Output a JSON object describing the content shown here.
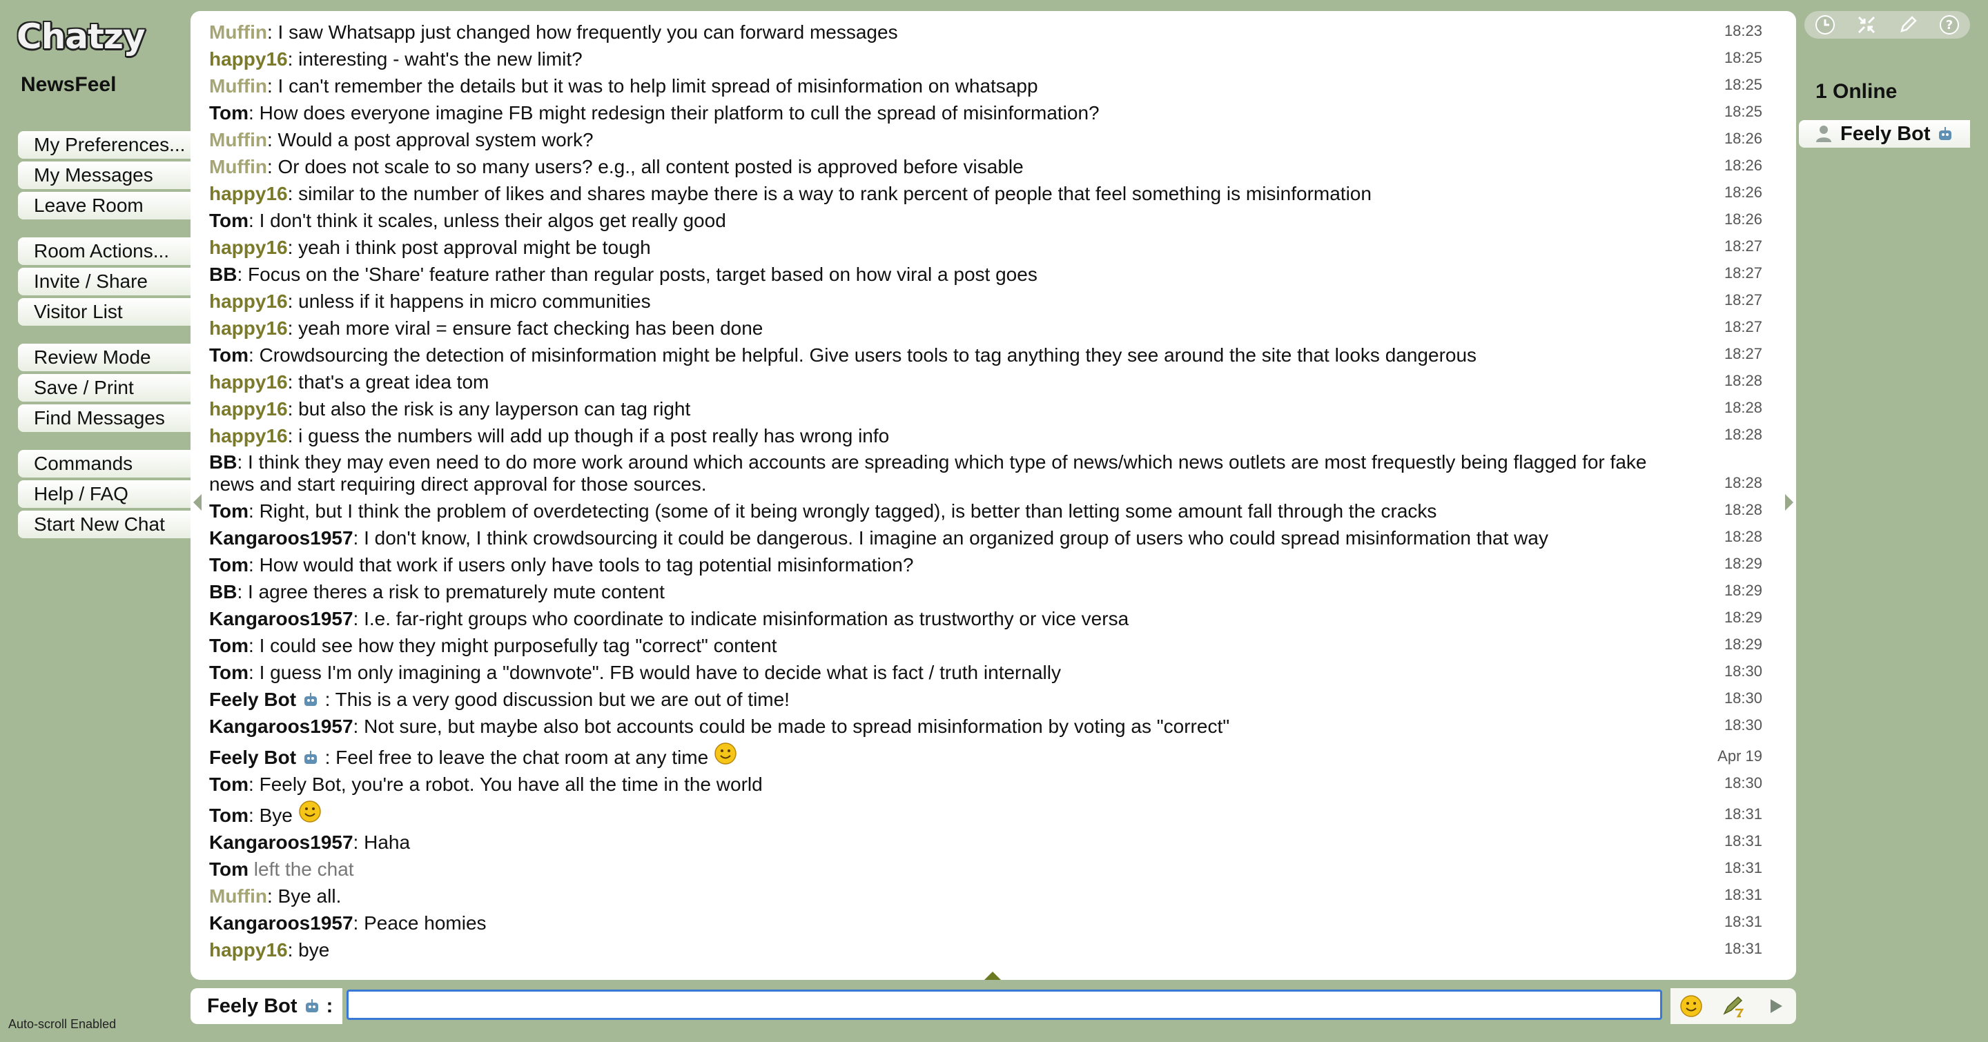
{
  "app": {
    "logo": "Chatzy",
    "room_name": "NewsFeel",
    "status": "Auto-scroll Enabled"
  },
  "menu": {
    "group1": [
      "My Preferences...",
      "My Messages",
      "Leave Room"
    ],
    "group2": [
      "Room Actions...",
      "Invite / Share",
      "Visitor List"
    ],
    "group3": [
      "Review Mode",
      "Save / Print",
      "Find Messages"
    ],
    "group4": [
      "Commands",
      "Help / FAQ",
      "Start New Chat"
    ]
  },
  "messages": [
    {
      "user": "Muffin",
      "color": "muffin",
      "text": ": I saw Whatsapp just changed how frequently you can forward messages",
      "time": "18:23"
    },
    {
      "user": "happy16",
      "color": "happy",
      "text": ": interesting - waht's the new limit?",
      "time": "18:25"
    },
    {
      "user": "Muffin",
      "color": "muffin",
      "text": ": I can't remember the details but it was to help limit spread of misinformation on whatsapp",
      "time": "18:25"
    },
    {
      "user": "Tom",
      "color": "dark",
      "text": ": How does everyone imagine FB might redesign their platform to cull the spread of misinformation?",
      "time": "18:25"
    },
    {
      "user": "Muffin",
      "color": "muffin",
      "text": ": Would a post approval system work?",
      "time": "18:26"
    },
    {
      "user": "Muffin",
      "color": "muffin",
      "text": ": Or does not scale to so many users? e.g., all content posted is approved before visable",
      "time": "18:26"
    },
    {
      "user": "happy16",
      "color": "happy",
      "text": ": similar to the number of likes and shares maybe there is a way to rank percent of people that feel something is misinformation",
      "time": "18:26"
    },
    {
      "user": "Tom",
      "color": "dark",
      "text": ": I don't think it scales, unless their algos get really good",
      "time": "18:26"
    },
    {
      "user": "happy16",
      "color": "happy",
      "text": ": yeah i think post approval might be tough",
      "time": "18:27"
    },
    {
      "user": "BB",
      "color": "dark",
      "text": ": Focus on the 'Share' feature rather than regular posts, target based on how viral a post goes",
      "time": "18:27"
    },
    {
      "user": "happy16",
      "color": "happy",
      "text": ": unless if it happens in micro communities",
      "time": "18:27"
    },
    {
      "user": "happy16",
      "color": "happy",
      "text": ": yeah more viral = ensure fact checking has been done",
      "time": "18:27"
    },
    {
      "user": "Tom",
      "color": "dark",
      "text": ": Crowdsourcing the detection of misinformation might be helpful. Give users tools to tag anything they see around the site that looks dangerous",
      "time": "18:27"
    },
    {
      "user": "happy16",
      "color": "happy",
      "text": ": that's a great idea tom",
      "time": "18:28"
    },
    {
      "user": "happy16",
      "color": "happy",
      "text": ": but also the risk is any layperson can tag right",
      "time": "18:28"
    },
    {
      "user": "happy16",
      "color": "happy",
      "text": ": i guess the numbers will add up though if a post really has wrong info",
      "time": "18:28"
    },
    {
      "user": "BB",
      "color": "dark",
      "text": ": I think they may even need to do more work around which accounts are spreading which type of news/which news outlets are most frequestly being flagged for fake news and start requiring direct approval for those sources.",
      "time": "18:28",
      "wrap": true
    },
    {
      "user": "Tom",
      "color": "dark",
      "text": ": Right, but I think the problem of overdetecting (some of it being wrongly tagged), is better than letting some amount fall through the cracks",
      "time": "18:28"
    },
    {
      "user": "Kangaroos1957",
      "color": "dark",
      "text": ": I don't know, I think crowdsourcing it could be dangerous. I imagine an organized group of users who could spread misinformation that way",
      "time": "18:28"
    },
    {
      "user": "Tom",
      "color": "dark",
      "text": ": How would that work if users only have tools to tag potential misinformation?",
      "time": "18:29"
    },
    {
      "user": "BB",
      "color": "dark",
      "text": ": I agree theres a risk to prematurely mute content",
      "time": "18:29"
    },
    {
      "user": "Kangaroos1957",
      "color": "dark",
      "text": ": I.e. far-right groups who coordinate to indicate misinformation as trustworthy or vice versa",
      "time": "18:29"
    },
    {
      "user": "Tom",
      "color": "dark",
      "text": ": I could see how they might purposefully tag \"correct\" content",
      "time": "18:29"
    },
    {
      "user": "Tom",
      "color": "dark",
      "text": ": I guess I'm only imagining a \"downvote\". FB would have to decide what is fact / truth internally",
      "time": "18:30"
    },
    {
      "user": "Feely Bot",
      "color": "dark",
      "bot": true,
      "text": " : This is a very good discussion but we are out of time!",
      "time": "18:30"
    },
    {
      "user": "Kangaroos1957",
      "color": "dark",
      "text": ": Not sure, but maybe also bot accounts could be made to spread misinformation by voting as \"correct\"",
      "time": "18:30"
    },
    {
      "user": "Feely Bot",
      "color": "dark",
      "bot": true,
      "text": " : Feel free to leave the chat room at any time ",
      "smiley": true,
      "time": "Apr 19"
    },
    {
      "user": "Tom",
      "color": "dark",
      "text": ": Feely Bot, you're a robot. You have all the time in the world",
      "time": "18:30"
    },
    {
      "user": "Tom",
      "color": "dark",
      "text": ": Bye ",
      "smiley": true,
      "time": "18:31"
    },
    {
      "user": "Kangaroos1957",
      "color": "dark",
      "text": ": Haha",
      "time": "18:31"
    },
    {
      "user": "Tom",
      "color": "dark",
      "action": true,
      "text": " left the chat",
      "time": "18:31"
    },
    {
      "user": "Muffin",
      "color": "muffin",
      "text": ": Bye all.",
      "time": "18:31"
    },
    {
      "user": "Kangaroos1957",
      "color": "dark",
      "text": ": Peace homies",
      "time": "18:31"
    },
    {
      "user": "happy16",
      "color": "happy",
      "text": ": bye",
      "time": "18:31"
    }
  ],
  "online": {
    "count_label": "1 Online",
    "users": [
      "Feely Bot"
    ]
  },
  "input": {
    "name_label": "Feely Bot",
    "name_suffix": " :",
    "value": "",
    "placeholder": ""
  },
  "colors": {
    "background": "#a5b996",
    "muffin": "#a6a575",
    "happy16": "#7a7a2a",
    "input_border": "#3a78d8"
  }
}
